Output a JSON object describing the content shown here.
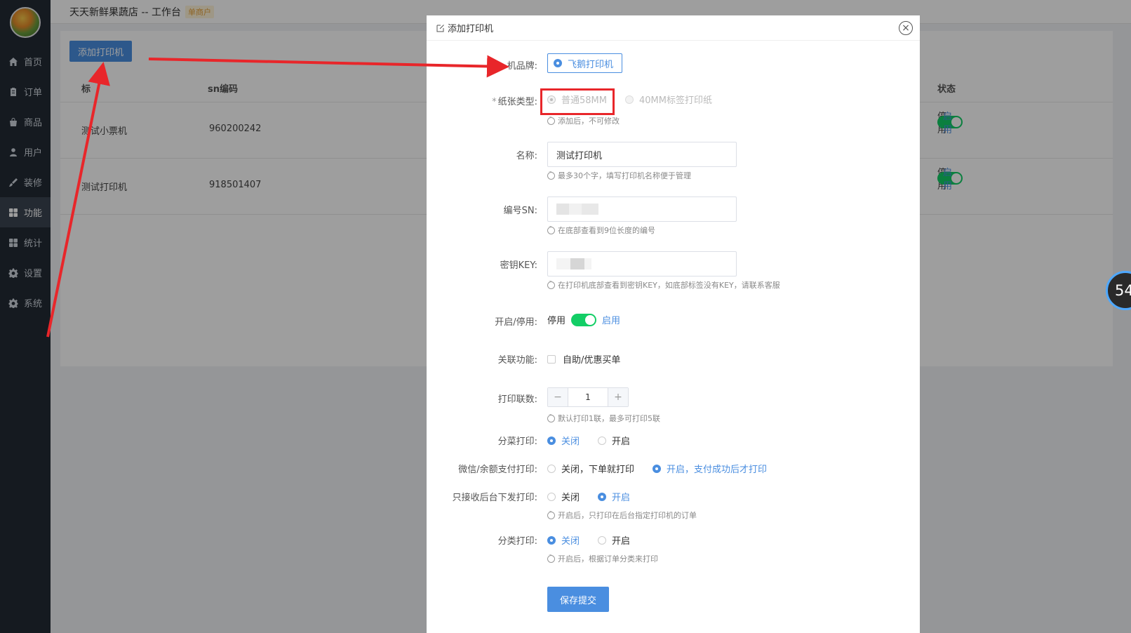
{
  "app": {
    "shop_name": "天天新鲜果蔬店 -- 工作台",
    "shop_tag": "单商户"
  },
  "sidebar": {
    "items": [
      {
        "label": "首页",
        "icon": "home-icon"
      },
      {
        "label": "订单",
        "icon": "clipboard-icon"
      },
      {
        "label": "商品",
        "icon": "bag-icon"
      },
      {
        "label": "用户",
        "icon": "user-icon"
      },
      {
        "label": "装修",
        "icon": "brush-icon"
      },
      {
        "label": "功能",
        "icon": "grid-icon",
        "active": true
      },
      {
        "label": "统计",
        "icon": "grid-icon"
      },
      {
        "label": "设置",
        "icon": "gear-icon"
      },
      {
        "label": "系统",
        "icon": "gear-icon"
      }
    ]
  },
  "page": {
    "add_button": "添加打印机",
    "columns": {
      "col1": "标",
      "col2": "sn编码",
      "status": "状态"
    },
    "rows": [
      {
        "name": "测试小票机",
        "sn": "960200242",
        "off": "停用",
        "on": "启用"
      },
      {
        "name": "测试打印机",
        "sn": "918501407",
        "off": "停用",
        "on": "启用"
      }
    ]
  },
  "modal": {
    "title": "添加打印机",
    "close": "×",
    "brand": {
      "label": "机品牌:",
      "value": "飞鹅打印机"
    },
    "paper": {
      "label": "纸张类型:",
      "required": "*",
      "options": [
        "普通58MM",
        "40MM标签打印纸"
      ],
      "hint": "添加后，不可修改"
    },
    "name": {
      "label": "名称:",
      "value": "测试打印机",
      "hint": "最多30个字，填写打印机名称便于管理"
    },
    "sn": {
      "label": "编号SN:",
      "hint": "在底部查看到9位长度的编号"
    },
    "key": {
      "label": "密钥KEY:",
      "hint": "在打印机底部查看到密钥KEY，如底部标签没有KEY，请联系客服"
    },
    "enable": {
      "label": "开启/停用:",
      "off": "停用",
      "on": "启用"
    },
    "related": {
      "label": "关联功能:",
      "option": "自助/优惠买单"
    },
    "copies": {
      "label": "打印联数:",
      "minus": "−",
      "value": "1",
      "plus": "+",
      "hint": "默认打印1联，最多可打印5联"
    },
    "split_print": {
      "label": "分菜打印:",
      "options": [
        "关闭",
        "开启"
      ],
      "selected": 0
    },
    "pay_print": {
      "label": "微信/余额支付打印:",
      "options": [
        "关闭，下单就打印",
        "开启，支付成功后才打印"
      ],
      "selected": 1
    },
    "backend_only": {
      "label": "只接收后台下发打印:",
      "options": [
        "关闭",
        "开启"
      ],
      "selected": 1,
      "hint": "开启后，只打印在后台指定打印机的订单"
    },
    "category_print": {
      "label": "分类打印:",
      "options": [
        "关闭",
        "开启"
      ],
      "selected": 0,
      "hint": "开启后，根据订单分类来打印"
    },
    "submit": "保存提交"
  },
  "timer": {
    "value": "54"
  },
  "colors": {
    "accent": "#4a8ee0",
    "switch_on": "#13ce66",
    "annotation": "#e8262a",
    "sidebar": "#222a35"
  }
}
